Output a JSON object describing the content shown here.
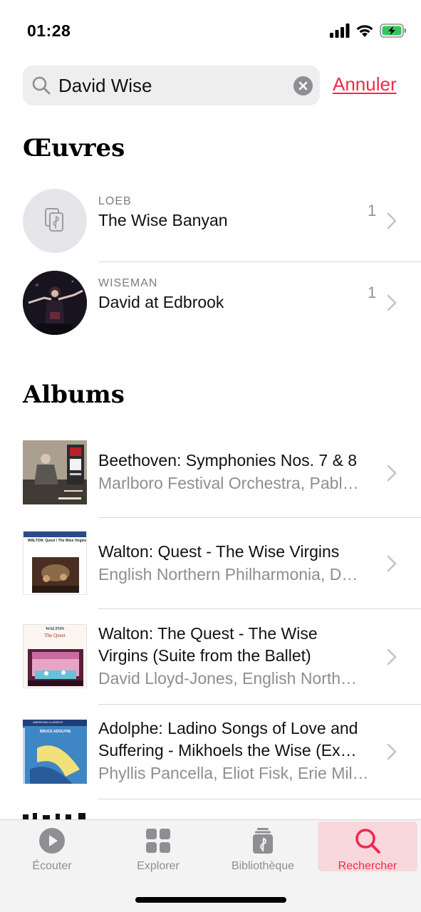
{
  "status": {
    "time": "01:28"
  },
  "search": {
    "query": "David Wise",
    "cancel_label": "Annuler"
  },
  "sections": {
    "works_title": "Œuvres",
    "albums_title": "Albums"
  },
  "works": [
    {
      "composer": "LOEB",
      "title": "The Wise Banyan",
      "count": "1",
      "thumb": "score-placeholder-icon"
    },
    {
      "composer": "WISEMAN",
      "title": "David at Edbrook",
      "count": "1",
      "thumb": "conductor-photo"
    }
  ],
  "albums": [
    {
      "title_line1": "Beethoven: Symphonies Nos. 7 & 8",
      "title_line2": "",
      "artist": "Marlboro Festival Orchestra, Pabl…"
    },
    {
      "title_line1": "Walton: Quest - The Wise Virgins",
      "title_line2": "",
      "artist": "English Northern Philharmonia, D…",
      "art_text": "WALTON: Quest / The Wise Virgins"
    },
    {
      "title_line1": "Walton: The Quest - The Wise",
      "title_line2": "Virgins (Suite from the Ballet)",
      "artist": "David Lloyd-Jones, English North…",
      "art_text_1": "WALTON",
      "art_text_2": "The Quest"
    },
    {
      "title_line1": "Adolphe: Ladino Songs of Love and",
      "title_line2": "Suffering - Mikhoels the Wise (Ex…",
      "artist": "Phyllis Pancella, Eliot Fisk, Erie Mil…",
      "art_text_1": "AMERICAN CLASSICS",
      "art_text_2": "BRUCE ADOLPHE"
    }
  ],
  "tabs": [
    {
      "label": "Écouter",
      "icon": "play-circle-icon",
      "active": false
    },
    {
      "label": "Explorer",
      "icon": "grid-icon",
      "active": false
    },
    {
      "label": "Bibliothèque",
      "icon": "library-icon",
      "active": false
    },
    {
      "label": "Rechercher",
      "icon": "search-icon",
      "active": true
    }
  ],
  "colors": {
    "accent": "#f0294d",
    "secondary_text": "#8e8e93",
    "search_bg": "#eeeeef",
    "battery_green": "#34c759"
  }
}
